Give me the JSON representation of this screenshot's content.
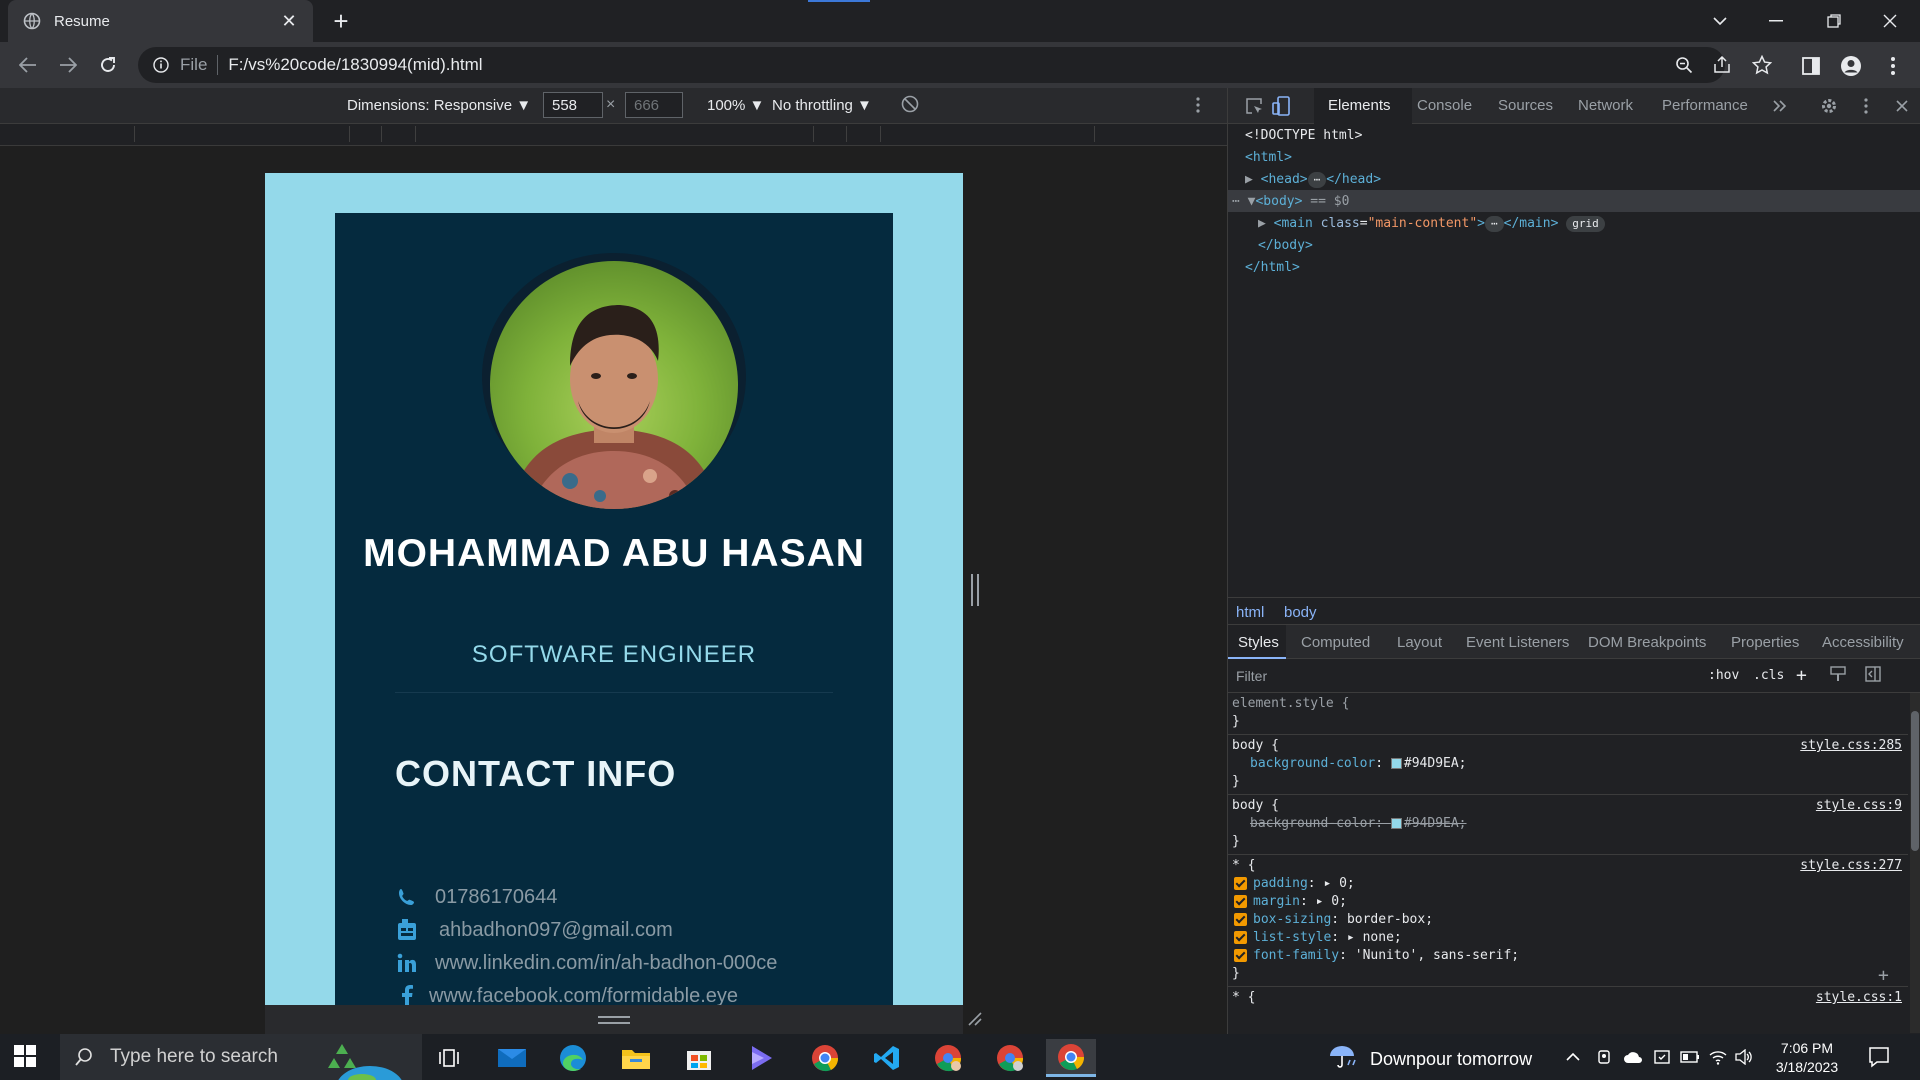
{
  "browser": {
    "tab_title": "Resume",
    "url_scheme_label": "File",
    "url": "F:/vs%20code/1830994(mid).html"
  },
  "device_toolbar": {
    "dimensions_label": "Dimensions: Responsive ▼",
    "width": "558",
    "height": "666",
    "zoom": "100% ▼",
    "throttling": "No throttling ▼"
  },
  "resume": {
    "name": "MOHAMMAD ABU HASAN",
    "title": "SOFTWARE ENGINEER",
    "contact_heading": "CONTACT INFO",
    "contacts": [
      {
        "icon": "phone-icon",
        "text": "01786170644"
      },
      {
        "icon": "email-icon",
        "text": "ahbadhon097@gmail.com"
      },
      {
        "icon": "linkedin-icon",
        "text": "www.linkedin.com/in/ah-badhon-000ce"
      },
      {
        "icon": "facebook-icon",
        "text": "www.facebook.com/formidable.eye"
      }
    ]
  },
  "devtools": {
    "tabs": [
      "Elements",
      "Console",
      "Sources",
      "Network",
      "Performance"
    ],
    "dom": {
      "doctype": "<!DOCTYPE html>",
      "html_open": "<html>",
      "head": "<head>",
      "head_close": "</head>",
      "body": "<body>",
      "body_marker": "== $0",
      "main_open": "<main",
      "main_attr": "class",
      "main_val": "\"main-content\"",
      "main_close": "</main>",
      "grid_badge": "grid",
      "body_close": "</body>",
      "html_close": "</html>"
    },
    "breadcrumbs": [
      "html",
      "body"
    ],
    "style_tabs": [
      "Styles",
      "Computed",
      "Layout",
      "Event Listeners",
      "DOM Breakpoints",
      "Properties",
      "Accessibility"
    ],
    "filter_placeholder": "Filter",
    "hov_label": ":hov",
    "cls_label": ".cls",
    "rules": {
      "element_style": "element.style {",
      "close": "}",
      "body_selector": "body {",
      "body_src_1": "style.css:285",
      "body_src_2": "style.css:9",
      "bg_prop": "background-color",
      "bg_val": "#94D9EA;",
      "star_selector": "* {",
      "star_src_1": "style.css:277",
      "star_src_2": "style.css:1",
      "star_props": [
        {
          "prop": "padding",
          "val": "0;",
          "arrow": true
        },
        {
          "prop": "margin",
          "val": "0;",
          "arrow": true
        },
        {
          "prop": "box-sizing",
          "val": "border-box;",
          "arrow": false
        },
        {
          "prop": "list-style",
          "val": "none;",
          "arrow": true
        },
        {
          "prop": "font-family",
          "val": "'Nunito', sans-serif;",
          "arrow": false
        }
      ]
    }
  },
  "taskbar": {
    "search_placeholder": "Type here to search",
    "weather": "Downpour tomorrow",
    "time": "7:06 PM",
    "date": "3/18/2023"
  },
  "colors": {
    "page_bg": "#94d9ea",
    "card_bg": "#052a3e",
    "accent": "#94d9ea"
  }
}
